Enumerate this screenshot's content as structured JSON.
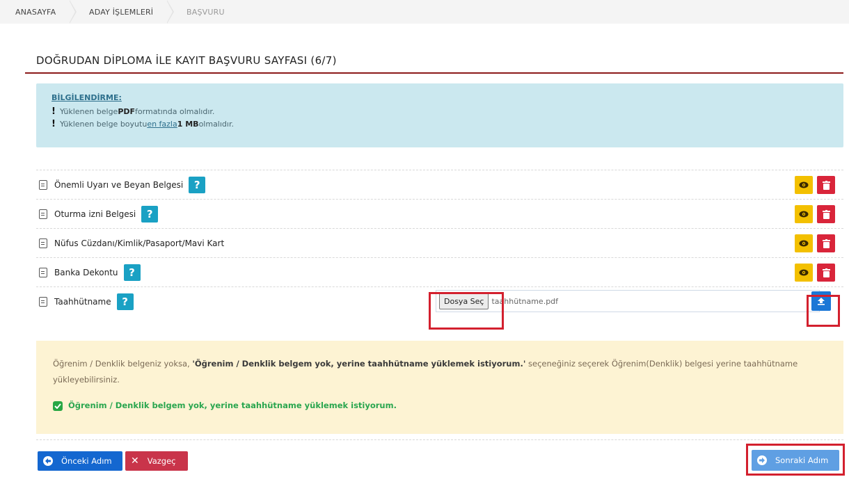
{
  "breadcrumb": {
    "items": [
      "ANASAYFA",
      "ADAY İŞLEMLERİ",
      "BAŞVURU"
    ]
  },
  "page": {
    "title": "DOĞRUDAN DİPLOMA İLE KAYIT BAŞVURU SAYFASI (6/7)"
  },
  "info": {
    "heading": "BİLGİLENDİRME:",
    "line1_pre": "Yüklenen belge ",
    "line1_bold": "PDF",
    "line1_post": " formatında olmalıdır.",
    "line2_pre": "Yüklenen belge boyutu ",
    "line2_under": "en fazla",
    "line2_space": " ",
    "line2_bold": "1 MB",
    "line2_post": " olmalıdır."
  },
  "documents": [
    {
      "label": "Önemli Uyarı ve Beyan Belgesi",
      "help": "?"
    },
    {
      "label": "Oturma izni Belgesi",
      "help": "?"
    },
    {
      "label": "Nüfus Cüzdanı/Kimlik/Pasaport/Mavi Kart"
    },
    {
      "label": "Banka Dekontu",
      "help": "?"
    },
    {
      "label": "Taahhütname",
      "help": "?"
    }
  ],
  "upload": {
    "choose_label": "Dosya Seç",
    "file_name": "taahhütname.pdf"
  },
  "warning": {
    "text_pre": "Öğrenim / Denklik belgeniz yoksa, ",
    "text_bold": "'Öğrenim / Denklik belgem yok, yerine taahhütname yüklemek istiyorum.'",
    "text_post": " seçeneğiniz seçerek Öğrenim(Denklik) belgesi yerine taahhütname yükleyebilirsiniz.",
    "checkbox_label": "Öğrenim / Denklik belgem yok, yerine taahhütname yüklemek istiyorum."
  },
  "buttons": {
    "prev": "Önceki Adım",
    "cancel": "Vazgeç",
    "next": "Sonraki Adım"
  },
  "colors": {
    "accent_rule": "#8b1a1a",
    "help": "#1aa1c4",
    "view": "#f3c000",
    "delete": "#d9253a",
    "highlight_frame": "#d3202e"
  }
}
